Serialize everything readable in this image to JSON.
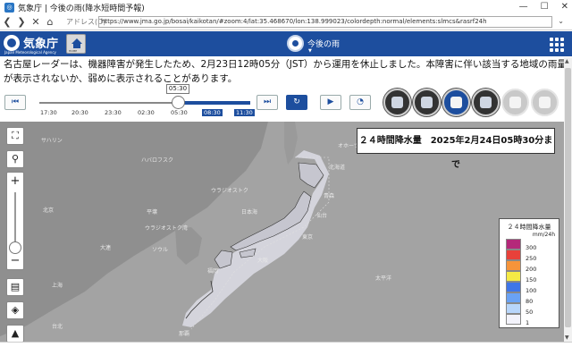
{
  "window": {
    "title": "気象庁 | 今後の雨(降水短時間予報)",
    "controls": [
      "—",
      "☐",
      "✕"
    ]
  },
  "browser": {
    "address_label": "アドレス(D)",
    "url": "https://www.jma.go.jp/bosai/kaikotan/#zoom:4/lat:35.468670/lon:138.999023/colordepth:normal/elements:slmcs&rasrf24h"
  },
  "header": {
    "logo_jp": "気象庁",
    "logo_en": "Japan Meteorological Agency",
    "home_label": "HOME",
    "mode_label": "今後の雨",
    "brand_color": "#1d4e9e"
  },
  "notice": "名古屋レーダーは、機器障害が発生したため、2月23日12時05分（JST）から運用を休止しました。本障害に伴い該当する地域の雨量が表示されないか、弱めに表示されることがあります。",
  "timeline": {
    "current_time": "05:30",
    "ticks": [
      "17:30",
      "20:30",
      "23:30",
      "02:30",
      "05:30",
      "08:30",
      "11:30"
    ],
    "highlighted_ticks": [
      "08:30",
      "11:30"
    ],
    "buttons": {
      "first": "⏮",
      "last": "⏭",
      "refresh": "↻",
      "play": "▶",
      "speed": "◔"
    }
  },
  "tools": [
    "rain-now",
    "rain-accum",
    "rain-24h",
    "grid",
    "snow",
    "snow-accum"
  ],
  "map": {
    "title": "２４時間降水量　2025年2月24日05時30分まで",
    "labels": [
      "サハリン",
      "ハバロフスク",
      "ウラジオストク",
      "北京",
      "ソウル",
      "平壌",
      "上海",
      "台北",
      "ウラジオストク湾",
      "大連",
      "日本海",
      "太平洋",
      "オホーツク海",
      "北海道",
      "青森",
      "仙台",
      "東京",
      "大阪",
      "福岡",
      "那覇"
    ]
  },
  "legend": {
    "title": "２４時間降水量",
    "unit": "mm/24h",
    "items": [
      {
        "value": "300",
        "color": "#b4287a"
      },
      {
        "value": "250",
        "color": "#e8413a"
      },
      {
        "value": "200",
        "color": "#f6943a"
      },
      {
        "value": "150",
        "color": "#f5ea45"
      },
      {
        "value": "100",
        "color": "#3f76e8"
      },
      {
        "value": "80",
        "color": "#6aa2f4"
      },
      {
        "value": "50",
        "color": "#b8d6fb"
      },
      {
        "value": "1",
        "color": "#f3f3fb"
      }
    ]
  }
}
